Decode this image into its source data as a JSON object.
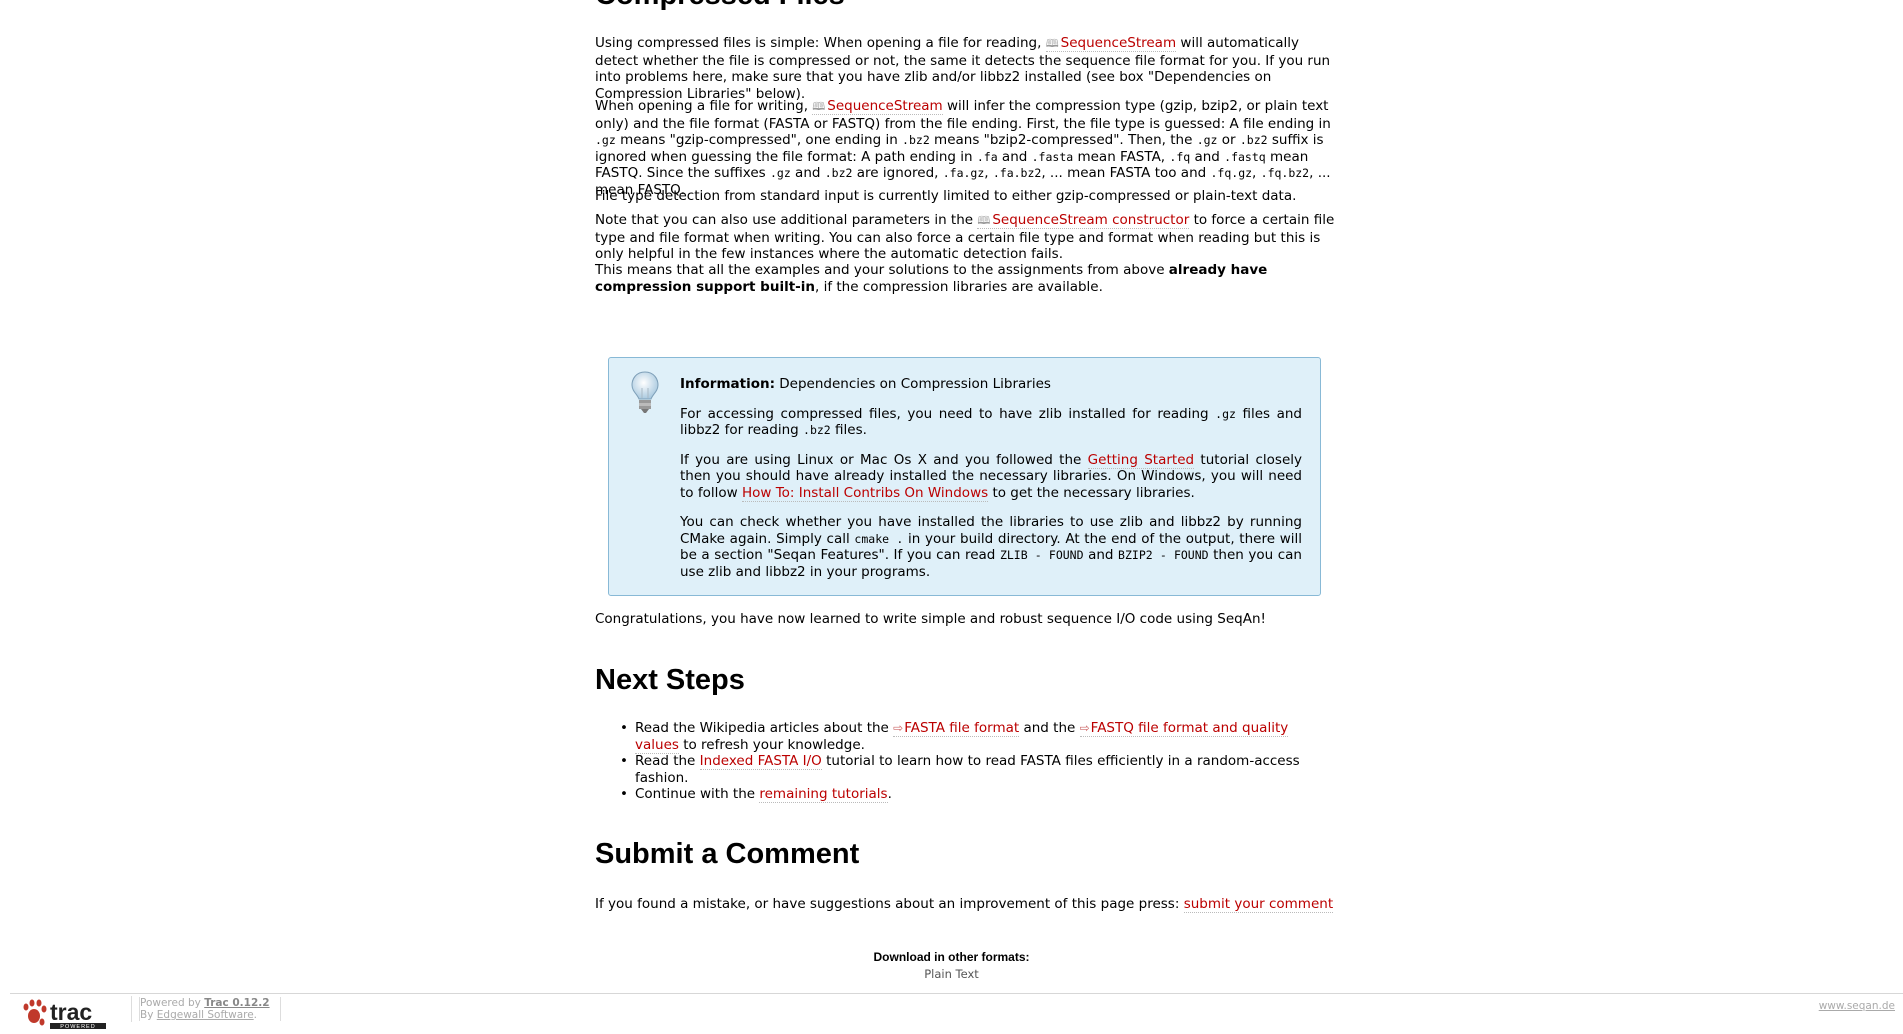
{
  "section_title": "Compressed Files",
  "paragraphs": {
    "p1": {
      "a": "Using compressed files is simple: When opening a file for reading, ",
      "link": "SequenceStream",
      "b": " will automatically detect whether the file is compressed or not, the same it detects the sequence file format for you. If you run into problems here, make sure that you have zlib and/or libbz2 installed (see box \"Dependencies on Compression Libraries\" below)."
    },
    "p2": {
      "a": "When opening a file for writing, ",
      "link": "SequenceStream",
      "b": " will infer the compression type (gzip, bzip2, or plain text only) and the file format (FASTA or FASTQ) from the file ending. First, the file type is guessed: A file ending in ",
      "c1": ".gz",
      "b2": " means \"gzip-compressed\", one ending in ",
      "c2": ".bz2",
      "b3": " means \"bzip2-compressed\". Then, the ",
      "c3": ".gz",
      "b4": " or ",
      "c4": ".bz2",
      "b5": " suffix is ignored when guessing the file format: A path ending in ",
      "c5": ".fa",
      "b6": " and ",
      "c6": ".fasta",
      "b7": " mean FASTA, ",
      "c7": ".fq",
      "b8": " and ",
      "c8": ".fastq",
      "b9": " mean FASTQ. Since the suffixes ",
      "c9": ".gz",
      "b10": " and ",
      "c10": ".bz2",
      "b11": " are ignored, ",
      "c11": ".fa.gz",
      "b12": ", ",
      "c12": ".fa.bz2",
      "b13": ", ... mean FASTA too and ",
      "c13": ".fq.gz",
      "b14": ", ",
      "c14": ".fq.bz2",
      "b15": ", ... mean FASTQ."
    },
    "p3": "File type detection from standard input is currently limited to either gzip-compressed or plain-text data.",
    "p4": {
      "a": "Note that you can also use additional parameters in the ",
      "link": "SequenceStream constructor",
      "b": " to force a certain file type and file format when writing. You can also force a certain file type and format when reading but this is only helpful in the few instances where the automatic detection fails."
    },
    "p5": {
      "a": "This means that all the examples and your solutions to the assignments from above ",
      "bold": "already have compression support built-in",
      "b": ", if the compression libraries are available."
    },
    "p6": "Congratulations, you have now learned to write simple and robust sequence I/O code using SeqAn!"
  },
  "info_box": {
    "label": "Information:",
    "title": "Dependencies on Compression Libraries",
    "i1": {
      "a": "For accessing compressed files, you need to have zlib installed for reading ",
      "c1": ".gz",
      "b": " files and libbz2 for reading ",
      "c2": ".bz2",
      "d": " files."
    },
    "i2": {
      "a": "If you are using Linux or Mac Os X and you followed the ",
      "link1": "Getting Started",
      "b": " tutorial closely then you should have already installed the necessary libraries. On Windows, you will need to follow ",
      "link2": "How To: Install Contribs On Windows",
      "c": " to get the necessary libraries."
    },
    "i3": {
      "a": "You can check whether you have installed the libraries to use zlib and libbz2 by running CMake again. Simply call ",
      "c1": "cmake .",
      "b": " in your build directory. At the end of the output, there will be a section \"Seqan Features\". If you can read ",
      "c2": "ZLIB - FOUND",
      "d": " and ",
      "c3": "BZIP2 - FOUND",
      "e": " then you can use zlib and libbz2 in your programs."
    }
  },
  "next_steps": {
    "title": "Next Steps",
    "s1": {
      "a": "Read the Wikipedia articles about the ",
      "link1": "FASTA file format",
      "b": " and the ",
      "link2": "FASTQ file format and quality values",
      "c": " to refresh your knowledge."
    },
    "s2": {
      "a": "Read the ",
      "link": "Indexed FASTA I/O",
      "b": " tutorial to learn how to read FASTA files efficiently in a random-access fashion."
    },
    "s3": {
      "a": "Continue with the ",
      "link": "remaining tutorials",
      "b": "."
    }
  },
  "comment": {
    "title": "Submit a Comment",
    "text": "If you found a mistake, or have suggestions about an improvement of this page press: ",
    "link": "submit your comment"
  },
  "download": {
    "title": "Download in other formats:",
    "plain_text": "Plain Text"
  },
  "footer": {
    "logo_text": "trac",
    "logo_sub": "POWERED",
    "powered_by": "Powered by ",
    "trac_version": "Trac 0.12.2",
    "by": "By ",
    "company": "Edgewall Software",
    "dot": ".",
    "site": "www.seqan.de"
  },
  "icons": {
    "wiki_link": "book-icon",
    "external_link": "external-link-icon",
    "info": "lightbulb-icon"
  },
  "colors": {
    "link": "#bb0000",
    "info_bg": "#dff0f9",
    "info_border": "#88b9d6"
  }
}
